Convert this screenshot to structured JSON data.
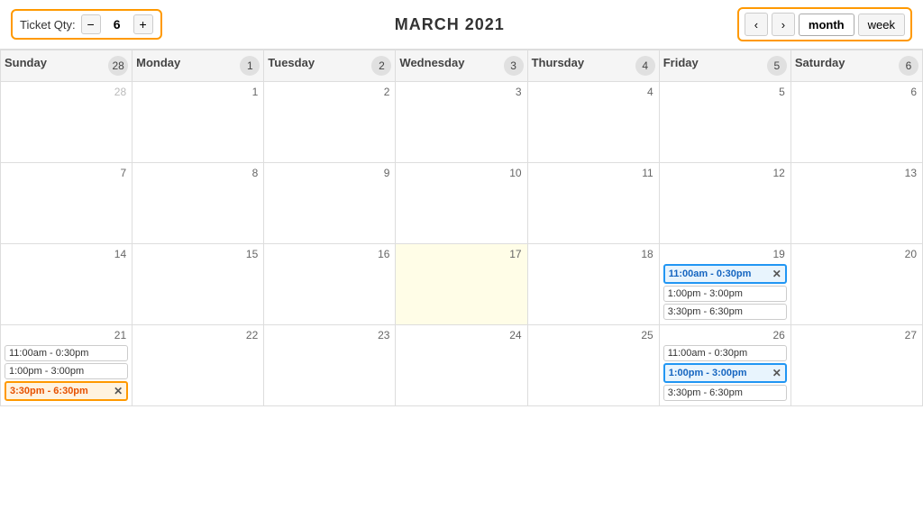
{
  "header": {
    "ticket_qty_label": "Ticket Qty:",
    "ticket_qty_value": "6",
    "minus_label": "−",
    "plus_label": "+",
    "month_title": "MARCH 2021",
    "prev_label": "‹",
    "next_label": "›",
    "month_view_label": "month",
    "week_view_label": "week"
  },
  "calendar": {
    "days": [
      {
        "name": "Sunday",
        "num": "28"
      },
      {
        "name": "Monday",
        "num": "1"
      },
      {
        "name": "Tuesday",
        "num": "2"
      },
      {
        "name": "Wednesday",
        "num": "3"
      },
      {
        "name": "Thursday",
        "num": "4"
      },
      {
        "name": "Friday",
        "num": "5"
      },
      {
        "name": "Saturday",
        "num": "6"
      }
    ],
    "weeks": [
      {
        "cells": [
          {
            "date": "28",
            "other": true,
            "slots": [],
            "highlight": false
          },
          {
            "date": "1",
            "other": false,
            "slots": [],
            "highlight": false
          },
          {
            "date": "2",
            "other": false,
            "slots": [],
            "highlight": false
          },
          {
            "date": "3",
            "other": false,
            "slots": [],
            "highlight": false
          },
          {
            "date": "4",
            "other": false,
            "slots": [],
            "highlight": false
          },
          {
            "date": "5",
            "other": false,
            "slots": [],
            "highlight": false
          },
          {
            "date": "6",
            "other": false,
            "slots": [],
            "highlight": false
          }
        ]
      },
      {
        "cells": [
          {
            "date": "7",
            "other": false,
            "slots": [],
            "highlight": false
          },
          {
            "date": "8",
            "other": false,
            "slots": [],
            "highlight": false
          },
          {
            "date": "9",
            "other": false,
            "slots": [],
            "highlight": false
          },
          {
            "date": "10",
            "other": false,
            "slots": [],
            "highlight": false
          },
          {
            "date": "11",
            "other": false,
            "slots": [],
            "highlight": false
          },
          {
            "date": "12",
            "other": false,
            "slots": [],
            "highlight": false
          },
          {
            "date": "13",
            "other": false,
            "slots": [],
            "highlight": false
          }
        ]
      },
      {
        "cells": [
          {
            "date": "14",
            "other": false,
            "slots": [],
            "highlight": false
          },
          {
            "date": "15",
            "other": false,
            "slots": [],
            "highlight": false
          },
          {
            "date": "16",
            "other": false,
            "slots": [],
            "highlight": false
          },
          {
            "date": "17",
            "other": false,
            "slots": [],
            "highlight": true
          },
          {
            "date": "18",
            "other": false,
            "slots": [],
            "highlight": false
          },
          {
            "date": "19",
            "other": false,
            "slots": [
              {
                "label": "11:00am - 0:30pm",
                "style": "selected-blue",
                "closeable": true
              },
              {
                "label": "1:00pm - 3:00pm",
                "style": "default",
                "closeable": false
              },
              {
                "label": "3:30pm - 6:30pm",
                "style": "default",
                "closeable": false
              }
            ],
            "highlight": false
          },
          {
            "date": "20",
            "other": false,
            "slots": [],
            "highlight": false
          }
        ]
      },
      {
        "cells": [
          {
            "date": "21",
            "other": false,
            "slots": [
              {
                "label": "11:00am - 0:30pm",
                "style": "default",
                "closeable": false
              },
              {
                "label": "1:00pm - 3:00pm",
                "style": "default",
                "closeable": false
              },
              {
                "label": "3:30pm - 6:30pm",
                "style": "selected-orange",
                "closeable": true
              }
            ],
            "highlight": false
          },
          {
            "date": "22",
            "other": false,
            "slots": [],
            "highlight": false
          },
          {
            "date": "23",
            "other": false,
            "slots": [],
            "highlight": false
          },
          {
            "date": "24",
            "other": false,
            "slots": [],
            "highlight": false
          },
          {
            "date": "25",
            "other": false,
            "slots": [],
            "highlight": false
          },
          {
            "date": "26",
            "other": false,
            "slots": [
              {
                "label": "11:00am - 0:30pm",
                "style": "default",
                "closeable": false
              },
              {
                "label": "1:00pm - 3:00pm",
                "style": "selected-blue",
                "closeable": true
              },
              {
                "label": "3:30pm - 6:30pm",
                "style": "default",
                "closeable": false
              }
            ],
            "highlight": false
          },
          {
            "date": "27",
            "other": false,
            "slots": [],
            "highlight": false
          }
        ]
      }
    ]
  }
}
